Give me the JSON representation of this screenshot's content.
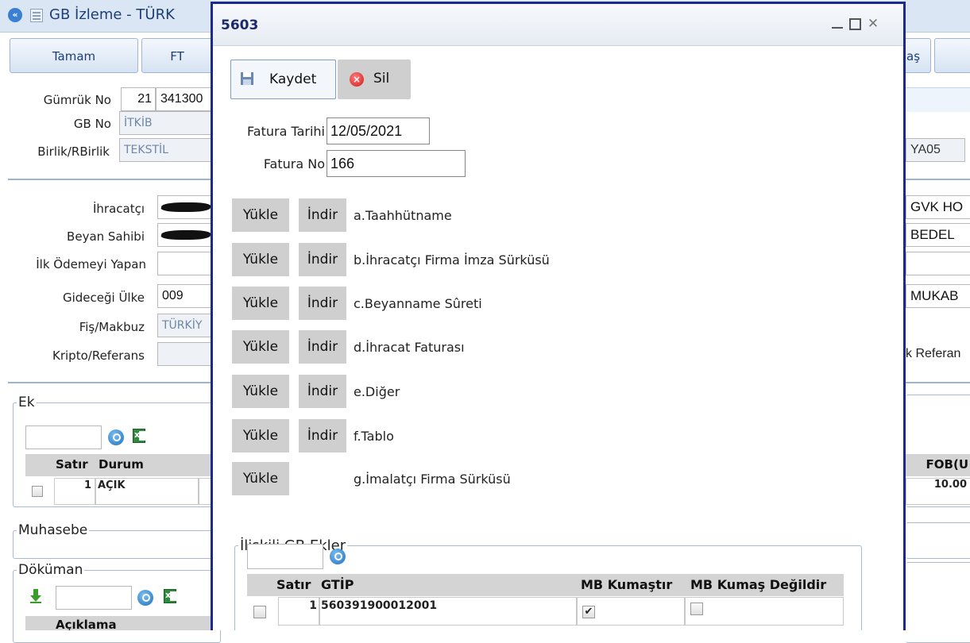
{
  "bg": {
    "title": "GB İzleme - TÜRK",
    "toolbar": {
      "tamam": "Tamam",
      "ft": "FT",
      "as": "aş"
    },
    "form": {
      "gumruk_no_label": "Gümrük No",
      "gumruk_no_1": "21",
      "gumruk_no_2": "341300",
      "gb_no_label": "GB No",
      "gb_no_value": "İTKİB",
      "birlik_label": "Birlik/RBirlik",
      "birlik_value": "TEKSTİL",
      "right_code": "YA05",
      "ihracatci_label": "İhracatçı",
      "beyan_label": "Beyan Sahibi",
      "ilk_odeme_label": "İlk Ödemeyi Yapan",
      "gidecegi_label": "Gideceği Ülke",
      "gidecegi_value": "009",
      "fis_label": "Fiş/Makbuz",
      "fis_value": "TÜRKİY",
      "kripto_label": "Kripto/Referans",
      "right_gvk": "GVK HO",
      "right_bedel": "BEDEL",
      "right_mukab": "MUKAB",
      "right_referans": "k Referan"
    },
    "ek": {
      "legend": "Ek",
      "col_satir": "Satır",
      "col_durum": "Durum",
      "col_fob": "FOB(U",
      "row_satir": "1",
      "row_durum": "AÇIK",
      "row_fob": "10.00"
    },
    "muhasebe_legend": "Muhasebe",
    "dokuman": {
      "legend": "Döküman",
      "col_aciklama": "Açıklama"
    }
  },
  "modal": {
    "title": "5603",
    "save_label": "Kaydet",
    "delete_label": "Sil",
    "fatura_tarihi_label": "Fatura Tarihi",
    "fatura_tarihi_value": "12/05/2021",
    "fatura_no_label": "Fatura No",
    "fatura_no_value": "166",
    "upload_label": "Yükle",
    "download_label": "İndir",
    "documents": [
      {
        "name": "a.Taahhütname",
        "has_download": true
      },
      {
        "name": "b.İhracatçı Firma İmza Sürküsü",
        "has_download": true
      },
      {
        "name": "c.Beyanname Sûreti",
        "has_download": true
      },
      {
        "name": "d.İhracat Faturası",
        "has_download": true
      },
      {
        "name": "e.Diğer",
        "has_download": true
      },
      {
        "name": "f.Tablo",
        "has_download": true
      },
      {
        "name": "g.İmalatçı Firma Sürküsü",
        "has_download": false
      }
    ],
    "related": {
      "legend": "İlişkili GB Ekler",
      "col_satir": "Satır",
      "col_gtip": "GTİP",
      "col_mb_kumas": "MB Kumaştır",
      "col_mb_kumas_degil": "MB Kumaş Değildir",
      "row_satir": "1",
      "row_gtip": "560391900012001",
      "row_mb_kumas_checked": true,
      "row_mb_kumas_degil_checked": false
    }
  },
  "colors": {
    "accent": "#1b2a8c",
    "panel": "#dbe6f5",
    "button_gray": "#cfcfcf"
  }
}
